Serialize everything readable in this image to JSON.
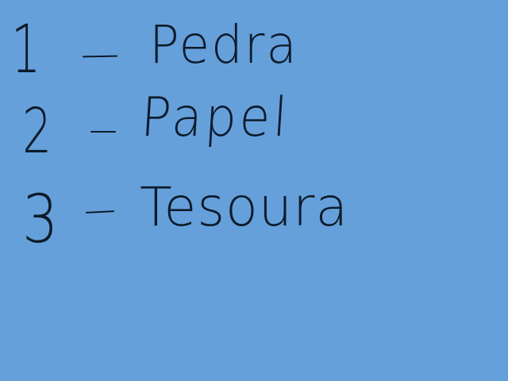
{
  "background_color": "#65a0db",
  "ink_color": "#0d1b2a",
  "options": [
    {
      "number": "1",
      "separator": "—",
      "label": "Pedra"
    },
    {
      "number": "2",
      "separator": "—",
      "label": "Papel"
    },
    {
      "number": "3",
      "separator": "—",
      "label": "Tesoura"
    }
  ]
}
